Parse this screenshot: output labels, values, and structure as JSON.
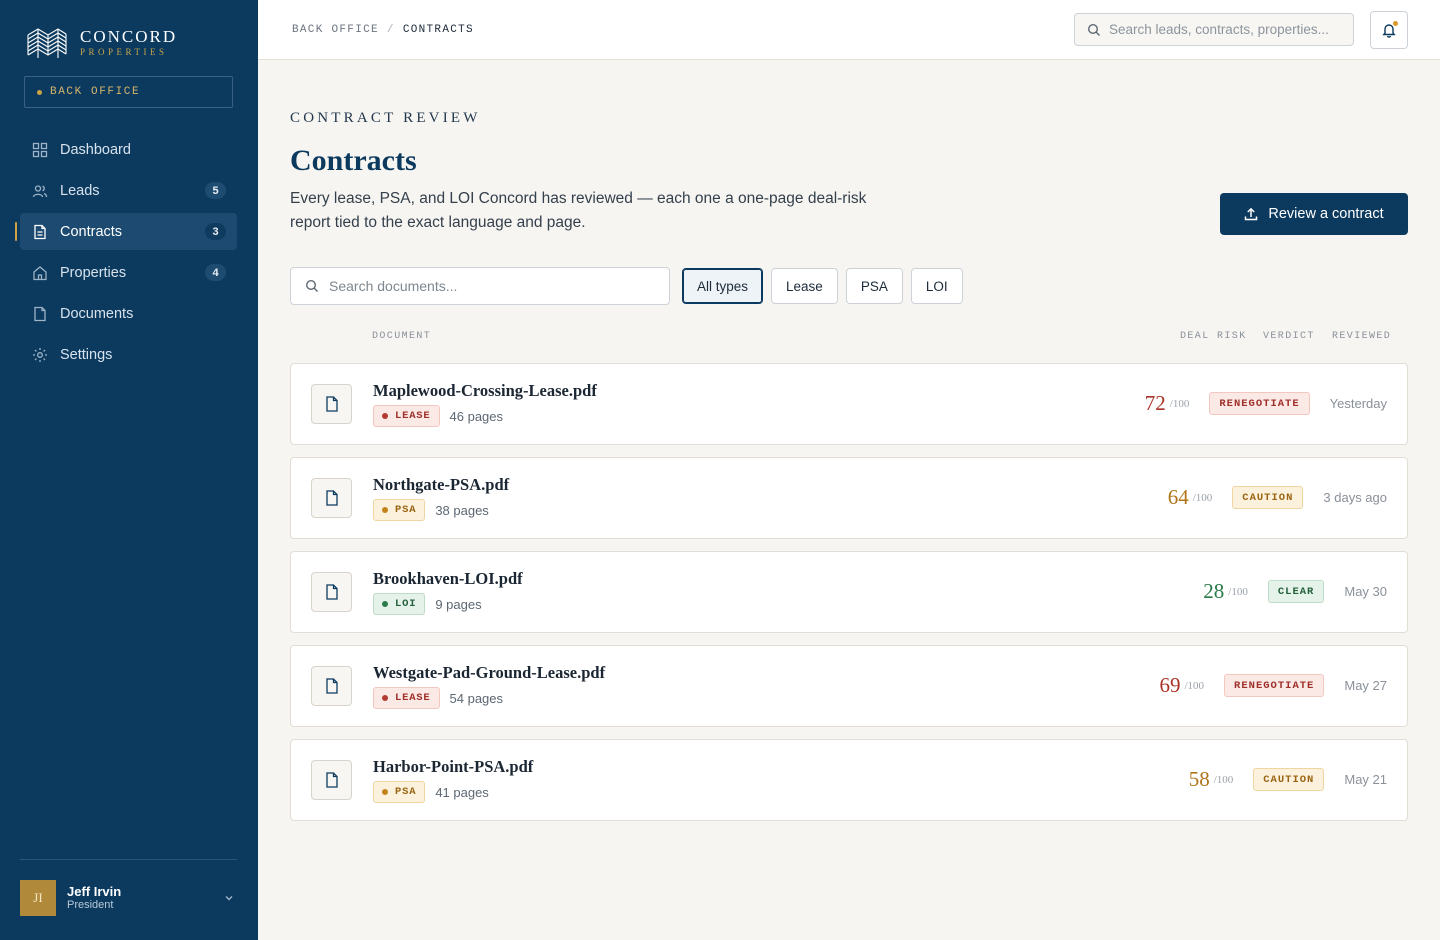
{
  "brand": {
    "name": "CONCORD",
    "sub": "PROPERTIES",
    "office_label": "BACK OFFICE",
    "accent": "#d0a243",
    "navy": "#0c3a5f"
  },
  "nav": [
    {
      "label": "Dashboard",
      "icon": "grid-icon",
      "badge": ""
    },
    {
      "label": "Leads",
      "icon": "users-icon",
      "badge": "5"
    },
    {
      "label": "Contracts",
      "icon": "file-text-icon",
      "badge": "3",
      "active": true
    },
    {
      "label": "Properties",
      "icon": "home-icon",
      "badge": "4"
    },
    {
      "label": "Documents",
      "icon": "file-icon",
      "badge": ""
    },
    {
      "label": "Settings",
      "icon": "gear-icon",
      "badge": ""
    }
  ],
  "user": {
    "initials": "JI",
    "name": "Jeff Irvin",
    "role": "President"
  },
  "topbar": {
    "breadcrumb": [
      "BACK OFFICE",
      "CONTRACTS"
    ],
    "breadcrumb_sep": "/",
    "search_placeholder": "Search leads, contracts, properties..."
  },
  "page": {
    "eyebrow": "CONTRACT REVIEW",
    "title": "Contracts",
    "description": "Every lease, PSA, and LOI Concord has reviewed — each one a one-page deal-risk report tied to the exact language and page.",
    "cta": "Review a contract"
  },
  "toolbar": {
    "search_placeholder": "Search documents...",
    "filters": [
      "All types",
      "Lease",
      "PSA",
      "LOI"
    ],
    "active_filter": "All types"
  },
  "columns": {
    "document": "DOCUMENT",
    "risk": "DEAL RISK",
    "verdict": "VERDICT",
    "reviewed": "REVIEWED"
  },
  "contracts": [
    {
      "name": "Maplewood-Crossing-Lease.pdf",
      "type": "LEASE",
      "pages": "46 pages",
      "score": "72",
      "score_max": "/100",
      "verdict": "RENEGOTIATE",
      "reviewed": "Yesterday"
    },
    {
      "name": "Northgate-PSA.pdf",
      "type": "PSA",
      "pages": "38 pages",
      "score": "64",
      "score_max": "/100",
      "verdict": "CAUTION",
      "reviewed": "3 days ago"
    },
    {
      "name": "Brookhaven-LOI.pdf",
      "type": "LOI",
      "pages": "9 pages",
      "score": "28",
      "score_max": "/100",
      "verdict": "CLEAR",
      "reviewed": "May 30"
    },
    {
      "name": "Westgate-Pad-Ground-Lease.pdf",
      "type": "LEASE",
      "pages": "54 pages",
      "score": "69",
      "score_max": "/100",
      "verdict": "RENEGOTIATE",
      "reviewed": "May 27"
    },
    {
      "name": "Harbor-Point-PSA.pdf",
      "type": "PSA",
      "pages": "41 pages",
      "score": "58",
      "score_max": "/100",
      "verdict": "CAUTION",
      "reviewed": "May 21"
    }
  ]
}
